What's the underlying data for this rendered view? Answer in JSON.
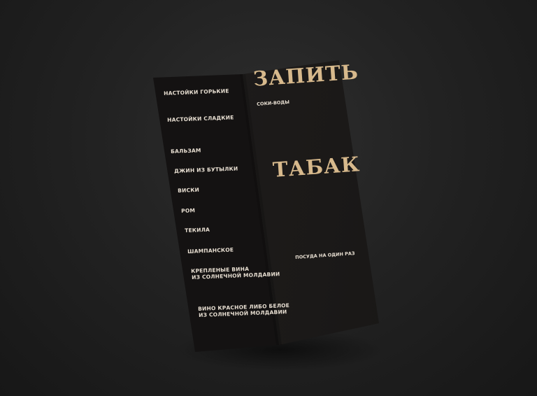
{
  "colors": {
    "background": "#222222",
    "menu_paper": "#1b1918",
    "title_gold": "#d7b98c",
    "text_cream": "#e8dfd2"
  },
  "left_panel": {
    "sections": [
      "НАСТОЙКИ ГОРЬКИЕ",
      "НАСТОЙКИ СЛАДКИЕ",
      "БАЛЬЗАМ",
      "ДЖИН ИЗ БУТЫЛКИ",
      "ВИСКИ",
      "РОМ",
      "ТЕКИЛА",
      "ШАМПАНСКОЕ",
      "КРЕПЛЕНЫЕ ВИНА",
      "ВИНО КРАСНОЕ ЛИБО БЕЛОЕ"
    ],
    "section_lines": [
      "ИЗ СОЛНЕЧНОЙ МОЛДАВИИ",
      "ИЗ СОЛНЕЧНОЙ МОЛДАВИИ"
    ]
  },
  "right_panel": {
    "title_drinks": "ЗАПИТЬ",
    "subheading_juices": "СОКИ-ВОДЫ",
    "title_tobacco": "ТАБАК",
    "subheading_dishes": "ПОСУДА НА ОДИН РАЗ"
  }
}
